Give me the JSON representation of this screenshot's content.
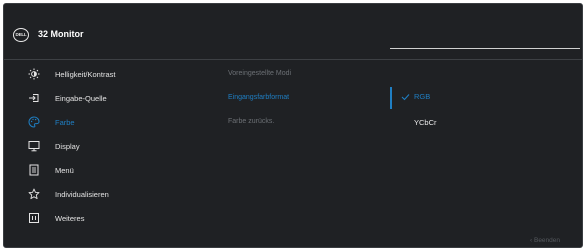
{
  "header": {
    "logo_text": "DELL",
    "title": "32 Monitor"
  },
  "nav": {
    "items": [
      {
        "label": "Helligkeit/Kontrast",
        "icon": "brightness-icon"
      },
      {
        "label": "Eingabe-Quelle",
        "icon": "input-source-icon"
      },
      {
        "label": "Farbe",
        "icon": "color-palette-icon",
        "active": true
      },
      {
        "label": "Display",
        "icon": "display-icon"
      },
      {
        "label": "Menü",
        "icon": "menu-icon"
      },
      {
        "label": "Individualisieren",
        "icon": "star-icon"
      },
      {
        "label": "Weiteres",
        "icon": "others-icon"
      }
    ]
  },
  "submenu": {
    "items": [
      {
        "label": "Voreingestellte Modi"
      },
      {
        "label": "Eingangsfarbformat",
        "active": true
      },
      {
        "label": "Farbe zurücks."
      }
    ]
  },
  "options": {
    "items": [
      {
        "label": "RGB",
        "selected": true
      },
      {
        "label": "YCbCr"
      }
    ]
  },
  "footer": {
    "exit_label": "Beenden",
    "exit_icon": "chevron-left-icon"
  },
  "colors": {
    "background": "#1f2124",
    "accent": "#1f7fc4",
    "text": "#e4e4e4",
    "muted": "#6c7075"
  }
}
